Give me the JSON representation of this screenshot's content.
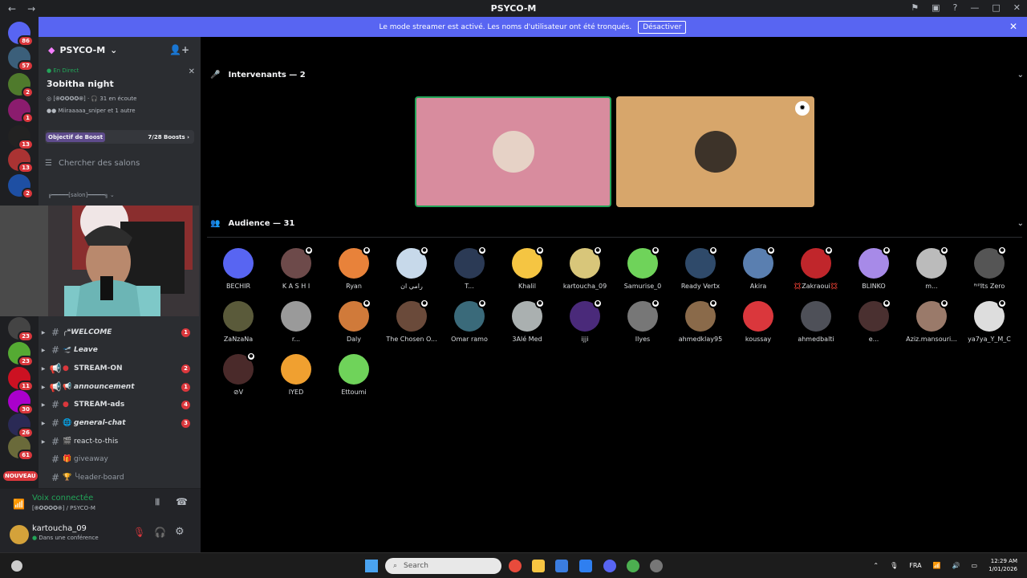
{
  "titlebar": {
    "title": "PSYCO-M"
  },
  "banner": {
    "text": "Le mode streamer est activé. Les noms d'utilisateur ont été tronqués.",
    "button": "Désactiver"
  },
  "rail": {
    "badges": [
      "86",
      "57",
      "2",
      "1",
      "13",
      "13",
      "2",
      "23",
      "23",
      "11",
      "30",
      "26",
      "61"
    ],
    "new_label": "NOUVEAU"
  },
  "sidebar": {
    "server_name": "PSYCO-M",
    "live_tag": "En Direct",
    "live_title": "3obitha night",
    "live_channel": "[֎✪✪✪✪֎]",
    "listeners": "31 en écoute",
    "listeners_names": "Miiraaaaa_sniper et 1 autre",
    "boost_label": "Objectif de Boost",
    "boost_count": "7/28 Boosts",
    "search_placeholder": "Chercher des salons",
    "salon_label": "╔━━━━━[salon]━━━━━╗"
  },
  "channels": [
    {
      "name": "╭❝WELCOME",
      "count": "1",
      "italic": true,
      "type": "text"
    },
    {
      "name": "Leave",
      "count": "",
      "italic": true,
      "type": "text"
    },
    {
      "name": "STREAM-ON",
      "count": "2",
      "italic": false,
      "type": "announce"
    },
    {
      "name": "announcement",
      "count": "1",
      "italic": true,
      "type": "announce"
    },
    {
      "name": "STREAM-ads",
      "count": "4",
      "italic": false,
      "type": "text"
    },
    {
      "name": "general-chat",
      "count": "3",
      "italic": true,
      "type": "text"
    },
    {
      "name": "react-to-this",
      "count": "",
      "italic": false,
      "type": "text"
    },
    {
      "name": "giveaway",
      "count": "",
      "italic": false,
      "type": "text",
      "muted": true
    },
    {
      "name": "╰leader-board",
      "count": "",
      "italic": false,
      "type": "text",
      "muted": true
    }
  ],
  "voice": {
    "status": "Voix connectée",
    "channel": "[֎✪✪✪✪֎] / PSYCO-M"
  },
  "user": {
    "name": "kartoucha_09",
    "status": "Dans une conférence"
  },
  "stage": {
    "speakers_label": "Intervenants — 2",
    "audience_label": "Audience — 31"
  },
  "audience": [
    "BECHIR",
    "K A S H I",
    "Ryan",
    "رامي ان",
    "T...",
    "Khalil",
    "kartoucha_09",
    "Samurise_0",
    "Ready Vertx",
    "Akira",
    "💢Zakraoui💢",
    "BLINKO",
    "m...",
    "ᴿᴵᴾIts Zero",
    "ZaNzaNa",
    "r...",
    "Daly",
    "The Chosen O...",
    "Omar ramo",
    "3Alé Med",
    "ijji",
    "Ilyes",
    "ahmedklay95",
    "koussay",
    "ahmedbalti",
    "e...",
    "Aziz.mansouri...",
    "ya7ya_Y_M_C",
    "⊘V",
    "IYED",
    "Ettoumi"
  ],
  "taskbar": {
    "search": "Search",
    "lang": "FRA",
    "time": "12:29 AM",
    "date": "1/01/2026"
  }
}
